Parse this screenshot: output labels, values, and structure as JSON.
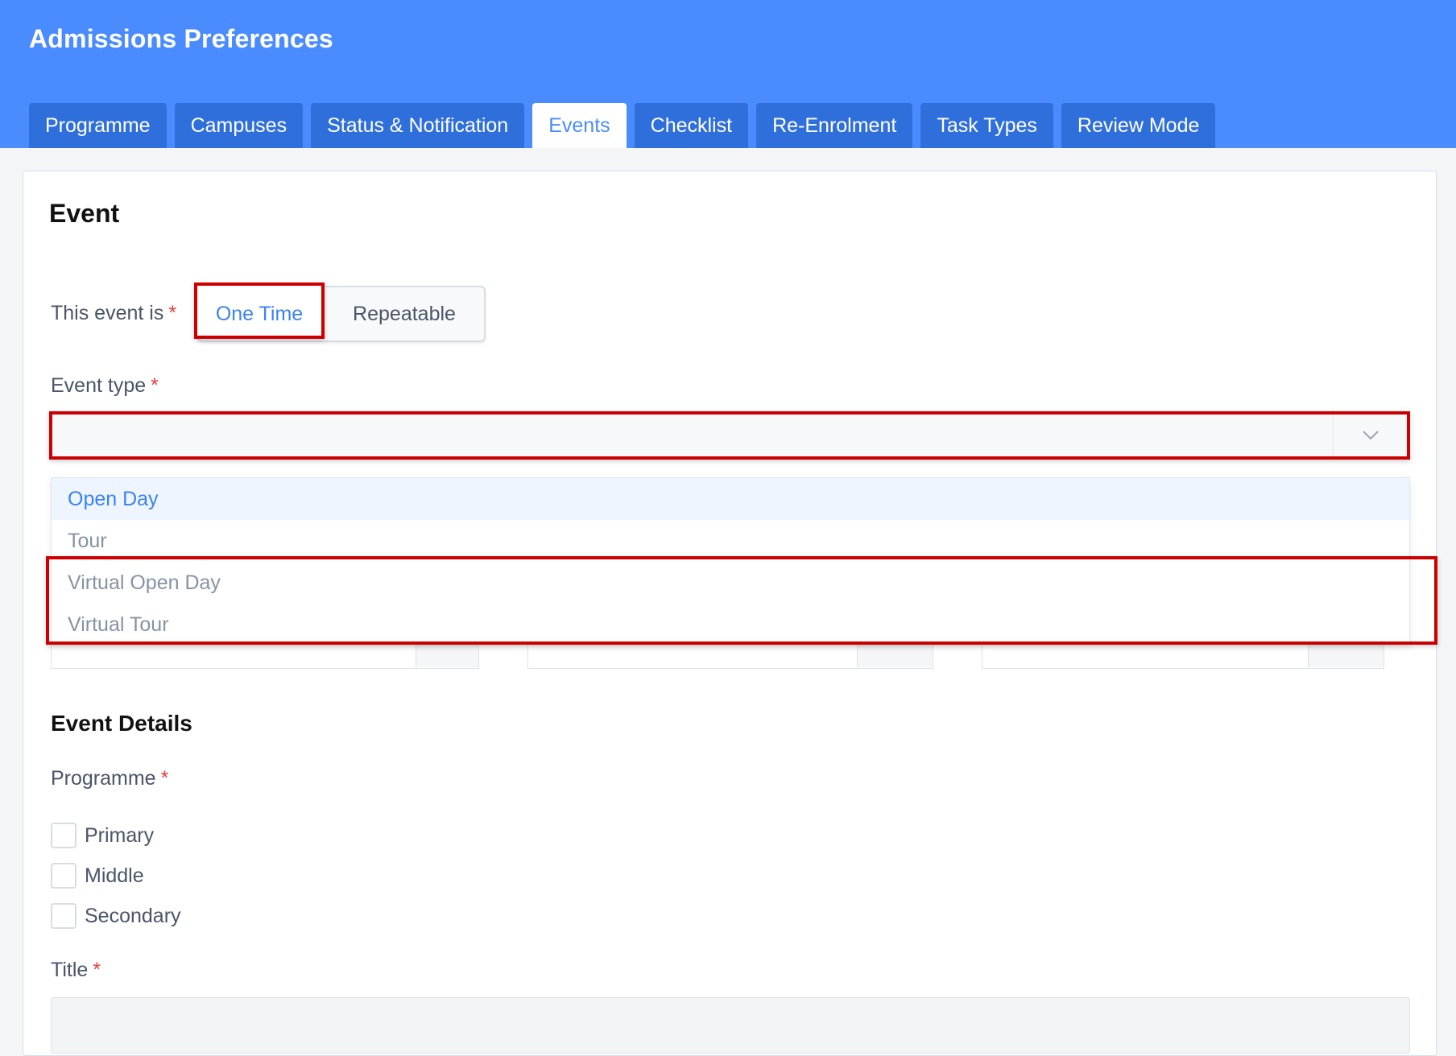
{
  "header": {
    "title": "Admissions Preferences"
  },
  "tabs": [
    {
      "label": "Programme",
      "active": false
    },
    {
      "label": "Campuses",
      "active": false
    },
    {
      "label": "Status & Notification",
      "active": false
    },
    {
      "label": "Events",
      "active": true
    },
    {
      "label": "Checklist",
      "active": false
    },
    {
      "label": "Re-Enrolment",
      "active": false
    },
    {
      "label": "Task Types",
      "active": false
    },
    {
      "label": "Review Mode",
      "active": false
    }
  ],
  "event_section": {
    "title": "Event",
    "occurrence": {
      "label": "This event is",
      "required_mark": "*",
      "options": [
        "One Time",
        "Repeatable"
      ],
      "selected": "One Time"
    },
    "event_type": {
      "label": "Event type",
      "required_mark": "*",
      "value": "",
      "options": [
        "Open Day",
        "Tour",
        "Virtual Open Day",
        "Virtual Tour"
      ],
      "hovered": "Open Day"
    }
  },
  "details_section": {
    "title": "Event Details",
    "programme": {
      "label": "Programme",
      "required_mark": "*",
      "options": [
        "Primary",
        "Middle",
        "Secondary"
      ]
    },
    "title_field": {
      "label": "Title",
      "required_mark": "*",
      "value": ""
    }
  },
  "colors": {
    "header": "#4a8cff",
    "tab": "#2f6fdc",
    "accent": "#3b82f6",
    "highlight": "#cc0000",
    "required": "#e53e3e"
  }
}
